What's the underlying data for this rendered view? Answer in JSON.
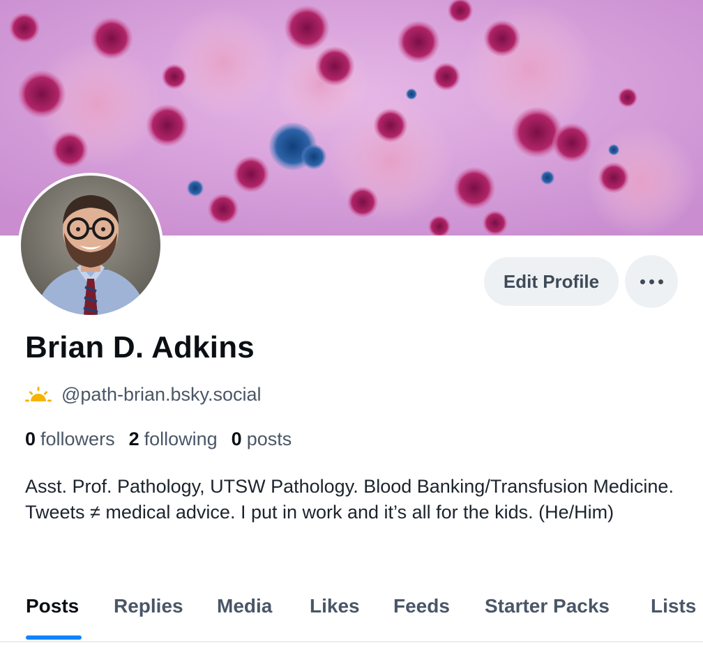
{
  "profile": {
    "display_name": "Brian D. Adkins",
    "handle": "@path-brian.bsky.social",
    "bio": "Asst. Prof. Pathology, UTSW Pathology. Blood Banking/Transfusion Medicine. Tweets ≠ medical advice. I put in work and it’s all for the kids. (He/Him)"
  },
  "stats": {
    "followers_count": "0",
    "followers_label": "followers",
    "following_count": "2",
    "following_label": "following",
    "posts_count": "0",
    "posts_label": "posts"
  },
  "actions": {
    "edit_profile_label": "Edit Profile"
  },
  "tabs": [
    {
      "label": "Posts",
      "active": true
    },
    {
      "label": "Replies",
      "active": false
    },
    {
      "label": "Media",
      "active": false
    },
    {
      "label": "Likes",
      "active": false
    },
    {
      "label": "Feeds",
      "active": false
    },
    {
      "label": "Starter Packs",
      "active": false
    },
    {
      "label": "Lists",
      "active": false
    }
  ],
  "icons": {
    "handle_badge": "sunrise-icon",
    "more": "more-dots-icon"
  },
  "colors": {
    "accent": "#1083fe",
    "button_bg": "#eef1f4",
    "text_primary": "#0b0f14",
    "text_secondary": "#4a5667",
    "sun": "#f5b400"
  }
}
